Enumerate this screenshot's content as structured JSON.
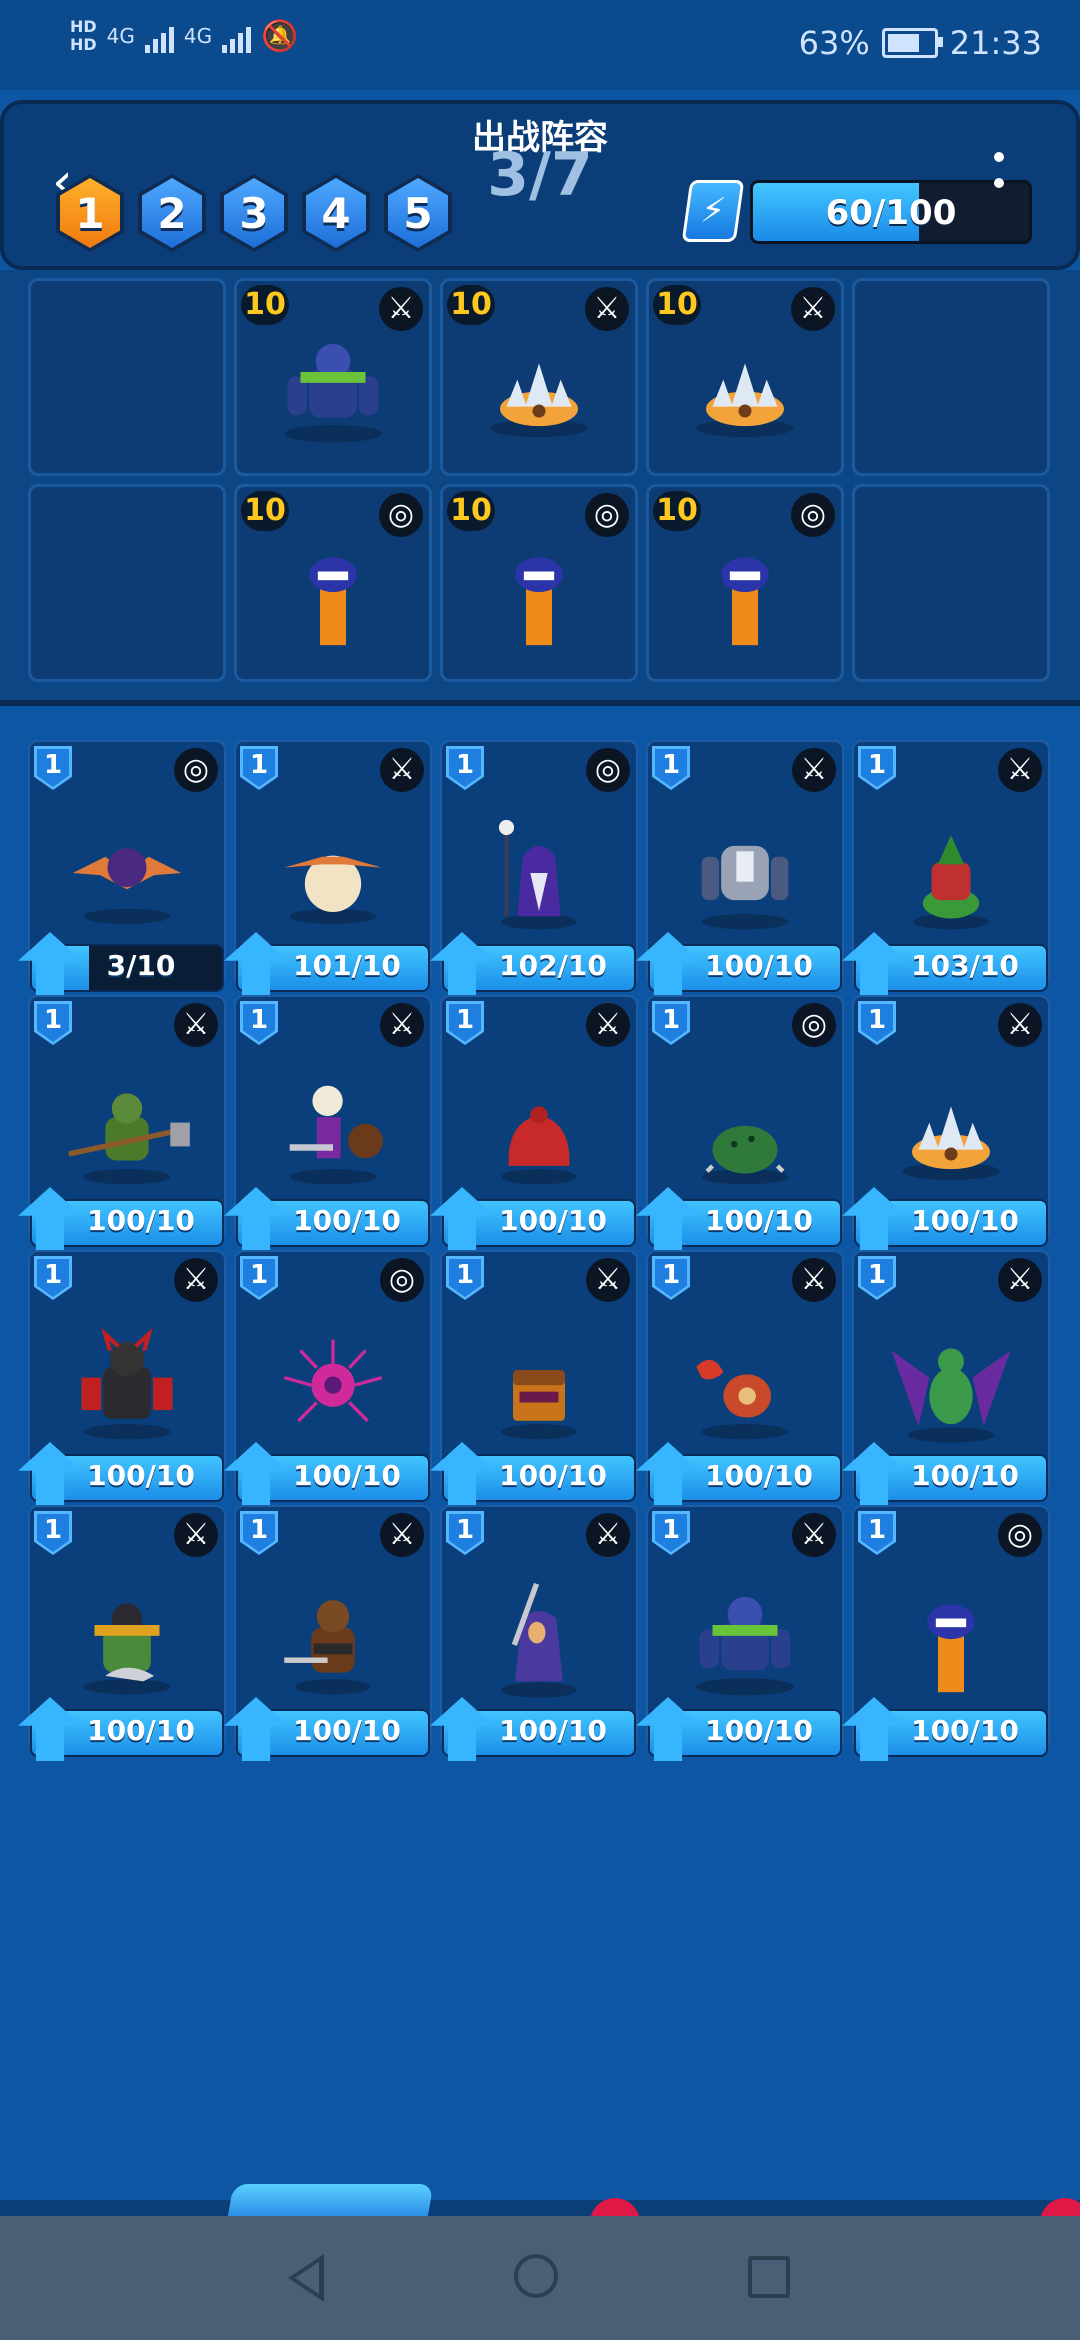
{
  "status": {
    "left": [
      "HD",
      "HD",
      "4G",
      "4G"
    ],
    "battery": "63%",
    "time": "21:33"
  },
  "header": {
    "title": "出战阵容",
    "count": "3/7",
    "slots": [
      "1",
      "2",
      "3",
      "4",
      "5"
    ],
    "active_slot": 0,
    "energy": "60/100",
    "energy_fraction": 0.6
  },
  "lineup": [
    {
      "level": "",
      "role": "",
      "monster": ""
    },
    {
      "level": "10",
      "role": "sword-icon",
      "monster": "werewolf"
    },
    {
      "level": "10",
      "role": "sword-icon",
      "monster": "spiked-shell"
    },
    {
      "level": "10",
      "role": "sword-icon",
      "monster": "spiked-shell"
    },
    {
      "level": "",
      "role": "",
      "monster": ""
    },
    {
      "level": "",
      "role": "",
      "monster": ""
    },
    {
      "level": "10",
      "role": "target-icon",
      "monster": "sandworm"
    },
    {
      "level": "10",
      "role": "target-icon",
      "monster": "sandworm"
    },
    {
      "level": "10",
      "role": "target-icon",
      "monster": "sandworm"
    },
    {
      "level": "",
      "role": "",
      "monster": ""
    }
  ],
  "collection": [
    {
      "level": "1",
      "role": "target-icon",
      "progress": "3/10",
      "progress_fraction": 0.3,
      "monster": "bat"
    },
    {
      "level": "1",
      "role": "sword-icon",
      "progress": "101/10",
      "progress_fraction": 1,
      "monster": "egg-creature"
    },
    {
      "level": "1",
      "role": "target-icon",
      "progress": "102/10",
      "progress_fraction": 1,
      "monster": "dark-wizard"
    },
    {
      "level": "1",
      "role": "sword-icon",
      "progress": "100/10",
      "progress_fraction": 1,
      "monster": "robot"
    },
    {
      "level": "1",
      "role": "sword-icon",
      "progress": "103/10",
      "progress_fraction": 1,
      "monster": "green-plant"
    },
    {
      "level": "1",
      "role": "sword-icon",
      "progress": "100/10",
      "progress_fraction": 1,
      "monster": "orc"
    },
    {
      "level": "1",
      "role": "sword-icon",
      "progress": "100/10",
      "progress_fraction": 1,
      "monster": "skeleton"
    },
    {
      "level": "1",
      "role": "sword-icon",
      "progress": "100/10",
      "progress_fraction": 1,
      "monster": "red-slime"
    },
    {
      "level": "1",
      "role": "target-icon",
      "progress": "100/10",
      "progress_fraction": 1,
      "monster": "turtle"
    },
    {
      "level": "1",
      "role": "sword-icon",
      "progress": "100/10",
      "progress_fraction": 1,
      "monster": "spiked-shell"
    },
    {
      "level": "1",
      "role": "sword-icon",
      "progress": "100/10",
      "progress_fraction": 1,
      "monster": "dark-knight"
    },
    {
      "level": "1",
      "role": "target-icon",
      "progress": "100/10",
      "progress_fraction": 1,
      "monster": "eye-orb"
    },
    {
      "level": "1",
      "role": "sword-icon",
      "progress": "100/10",
      "progress_fraction": 1,
      "monster": "mimic-chest"
    },
    {
      "level": "1",
      "role": "sword-icon",
      "progress": "100/10",
      "progress_fraction": 1,
      "monster": "crab"
    },
    {
      "level": "1",
      "role": "sword-icon",
      "progress": "100/10",
      "progress_fraction": 1,
      "monster": "dragon"
    },
    {
      "level": "1",
      "role": "sword-icon",
      "progress": "100/10",
      "progress_fraction": 1,
      "monster": "armored-orc"
    },
    {
      "level": "1",
      "role": "sword-icon",
      "progress": "100/10",
      "progress_fraction": 1,
      "monster": "bear-warrior"
    },
    {
      "level": "1",
      "role": "sword-icon",
      "progress": "100/10",
      "progress_fraction": 1,
      "monster": "hooded-rogue"
    },
    {
      "level": "1",
      "role": "sword-icon",
      "progress": "100/10",
      "progress_fraction": 1,
      "monster": "werewolf"
    },
    {
      "level": "1",
      "role": "target-icon",
      "progress": "100/10",
      "progress_fraction": 1,
      "monster": "sandworm"
    }
  ],
  "colors": {
    "background": "#0d56a3",
    "active_slot": "#ef7a10",
    "level_gold": "#ffc81e",
    "progress_blue": "#1c8fe8"
  }
}
